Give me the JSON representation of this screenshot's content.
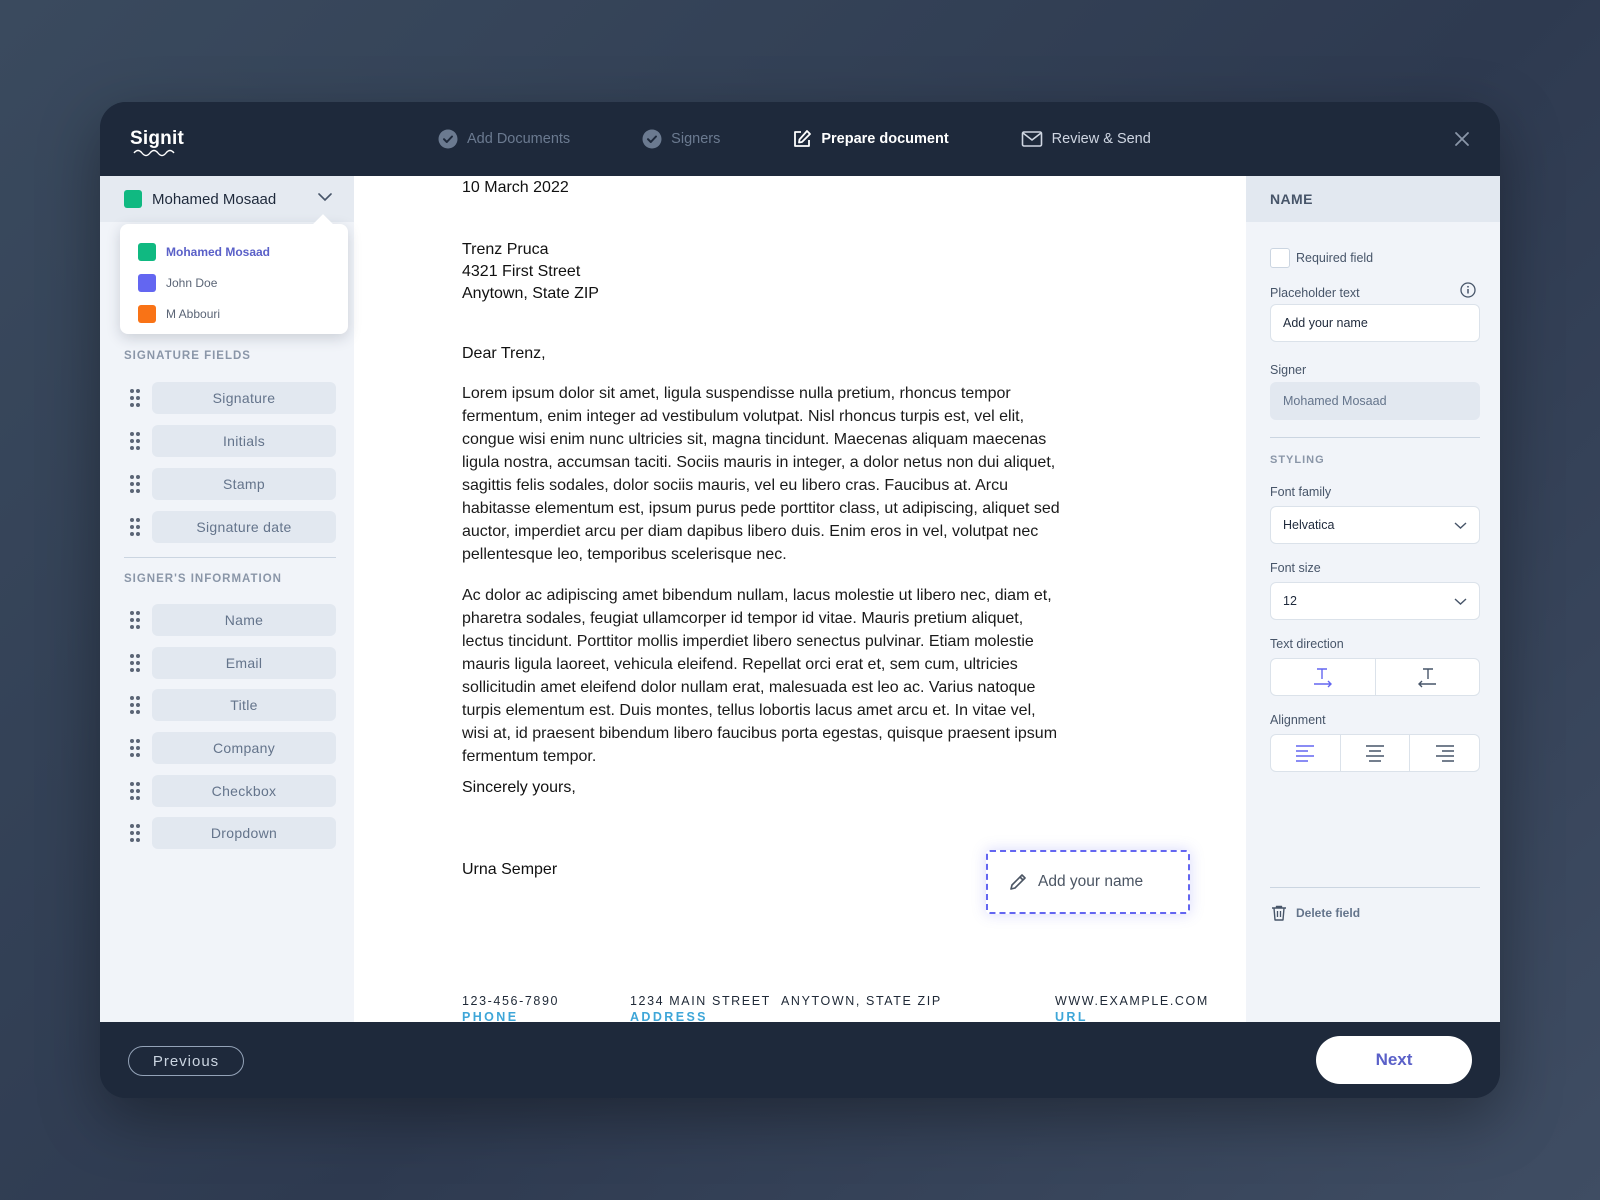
{
  "app": {
    "logo": "Signit"
  },
  "steps": [
    {
      "label": "Add Documents",
      "state": "done"
    },
    {
      "label": "Signers",
      "state": "done"
    },
    {
      "label": "Prepare document",
      "state": "active"
    },
    {
      "label": "Review & Send",
      "state": "upcoming"
    }
  ],
  "signer_select": {
    "selected": "Mohamed Mosaad",
    "options": [
      {
        "name": "Mohamed Mosaad",
        "color": "#10b981"
      },
      {
        "name": "John Doe",
        "color": "#6366f1"
      },
      {
        "name": "M Abbouri",
        "color": "#f97316"
      }
    ]
  },
  "signature_fields": {
    "title": "SIGNATURE FIELDS",
    "items": [
      "Signature",
      "Initials",
      "Stamp",
      "Signature date"
    ]
  },
  "signer_info": {
    "title": "SIGNER'S INFORMATION",
    "items": [
      "Name",
      "Email",
      "Title",
      "Company",
      "Checkbox",
      "Dropdown"
    ]
  },
  "document": {
    "date": "10 March 2022",
    "recipient_name": "Trenz Pruca",
    "recipient_street": "4321 First Street",
    "recipient_city": "Anytown, State ZIP",
    "salutation": "Dear Trenz,",
    "paragraph1": "Lorem ipsum dolor sit amet, ligula suspendisse nulla pretium, rhoncus tempor fermentum, enim integer ad vestibulum volutpat. Nisl rhoncus turpis est, vel elit, congue wisi enim nunc ultricies sit, magna tincidunt. Maecenas aliquam maecenas ligula nostra, accumsan taciti. Sociis mauris in integer, a dolor netus non dui aliquet, sagittis felis sodales, dolor sociis mauris, vel eu libero cras. Faucibus at. Arcu habitasse elementum est, ipsum purus pede porttitor class, ut adipiscing, aliquet sed auctor, imperdiet arcu per diam dapibus libero duis. Enim eros in vel, volutpat nec pellentesque leo, temporibus scelerisque nec.",
    "paragraph2": "Ac dolor ac adipiscing amet bibendum nullam, lacus molestie ut libero nec, diam et, pharetra sodales, feugiat ullamcorper id tempor id vitae. Mauris pretium aliquet, lectus tincidunt. Porttitor mollis imperdiet libero senectus pulvinar. Etiam molestie mauris ligula laoreet, vehicula eleifend. Repellat orci erat et, sem cum, ultricies sollicitudin amet eleifend dolor nullam erat, malesuada est leo ac. Varius natoque turpis elementum est. Duis montes, tellus lobortis lacus amet arcu et. In vitae vel, wisi at, id praesent bibendum libero faucibus porta egestas, quisque praesent ipsum fermentum tempor.",
    "closing": "Sincerely yours,",
    "sender": "Urna Semper",
    "sig_field_placeholder": "Add your name",
    "footer": {
      "phone": "123-456-7890",
      "phone_label": "PHONE",
      "address": "1234 MAIN STREET",
      "address_label": "ADDRESS",
      "city": "ANYTOWN, STATE ZIP",
      "url": "WWW.EXAMPLE.COM",
      "url_label": "URL"
    }
  },
  "properties": {
    "header": "NAME",
    "required_label": "Required field",
    "placeholder_label": "Placeholder text",
    "placeholder_value": "Add your name",
    "signer_label": "Signer",
    "signer_value": "Mohamed Mosaad",
    "styling_title": "STYLING",
    "font_family_label": "Font family",
    "font_family_value": "Helvatica",
    "font_size_label": "Font size",
    "font_size_value": "12",
    "text_direction_label": "Text direction",
    "alignment_label": "Alignment",
    "delete_label": "Delete field"
  },
  "footer_nav": {
    "previous": "Previous",
    "next": "Next"
  },
  "colors": {
    "accent": "#6366f1",
    "link_blue": "#3ea6d8",
    "dark": "#1e293b"
  }
}
